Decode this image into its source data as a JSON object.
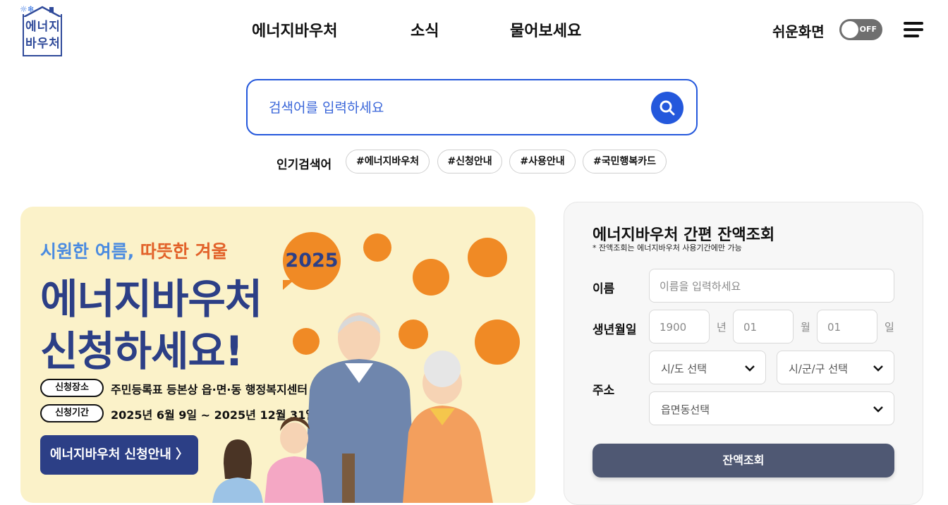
{
  "header": {
    "logo_text": "에너지\n바우처",
    "nav": [
      "에너지바우처",
      "소식",
      "물어보세요"
    ],
    "easy_view_label": "쉬운화면",
    "toggle_state": "OFF"
  },
  "search": {
    "placeholder": "검색어를 입력하세요",
    "popular_label": "인기검색어",
    "chips": [
      "#에너지바우처",
      "#신청안내",
      "#사용안내",
      "#국민행복카드"
    ]
  },
  "banner": {
    "tag_blue": "시원한 여름,",
    "tag_orange": "따뜻한 겨울",
    "title_line1": "에너지바우처",
    "title_line2": "신청하세요!",
    "place_label": "신청장소",
    "place_value": "주민등록표 등본상 읍·면·동 행정복지센터",
    "period_label": "신청기간",
    "period_value": "2025년 6월 9일 ~ 2025년 12월 31일",
    "cta": "에너지바우처 신청안내 〉",
    "year_badge": "2025"
  },
  "balance_panel": {
    "title": "에너지바우처 간편 잔액조회",
    "note": "* 잔액조회는 에너지바우처 사용기간에만 가능",
    "name_label": "이름",
    "name_placeholder": "이름을 입력하세요",
    "birth_label": "생년월일",
    "birth_year_placeholder": "1900",
    "birth_year_unit": "년",
    "birth_month_placeholder": "01",
    "birth_month_unit": "월",
    "birth_day_placeholder": "01",
    "birth_day_unit": "일",
    "address_label": "주소",
    "sido_select": "시/도 선택",
    "sigungu_select": "시/군/구 선택",
    "dong_select": "읍면동선택",
    "submit": "잔액조회"
  },
  "colors": {
    "primary_blue": "#2458dc",
    "navy": "#2c3f86",
    "orange": "#f08a25",
    "banner_bg": "#fbf2c9",
    "button_gray": "#4f5873"
  }
}
